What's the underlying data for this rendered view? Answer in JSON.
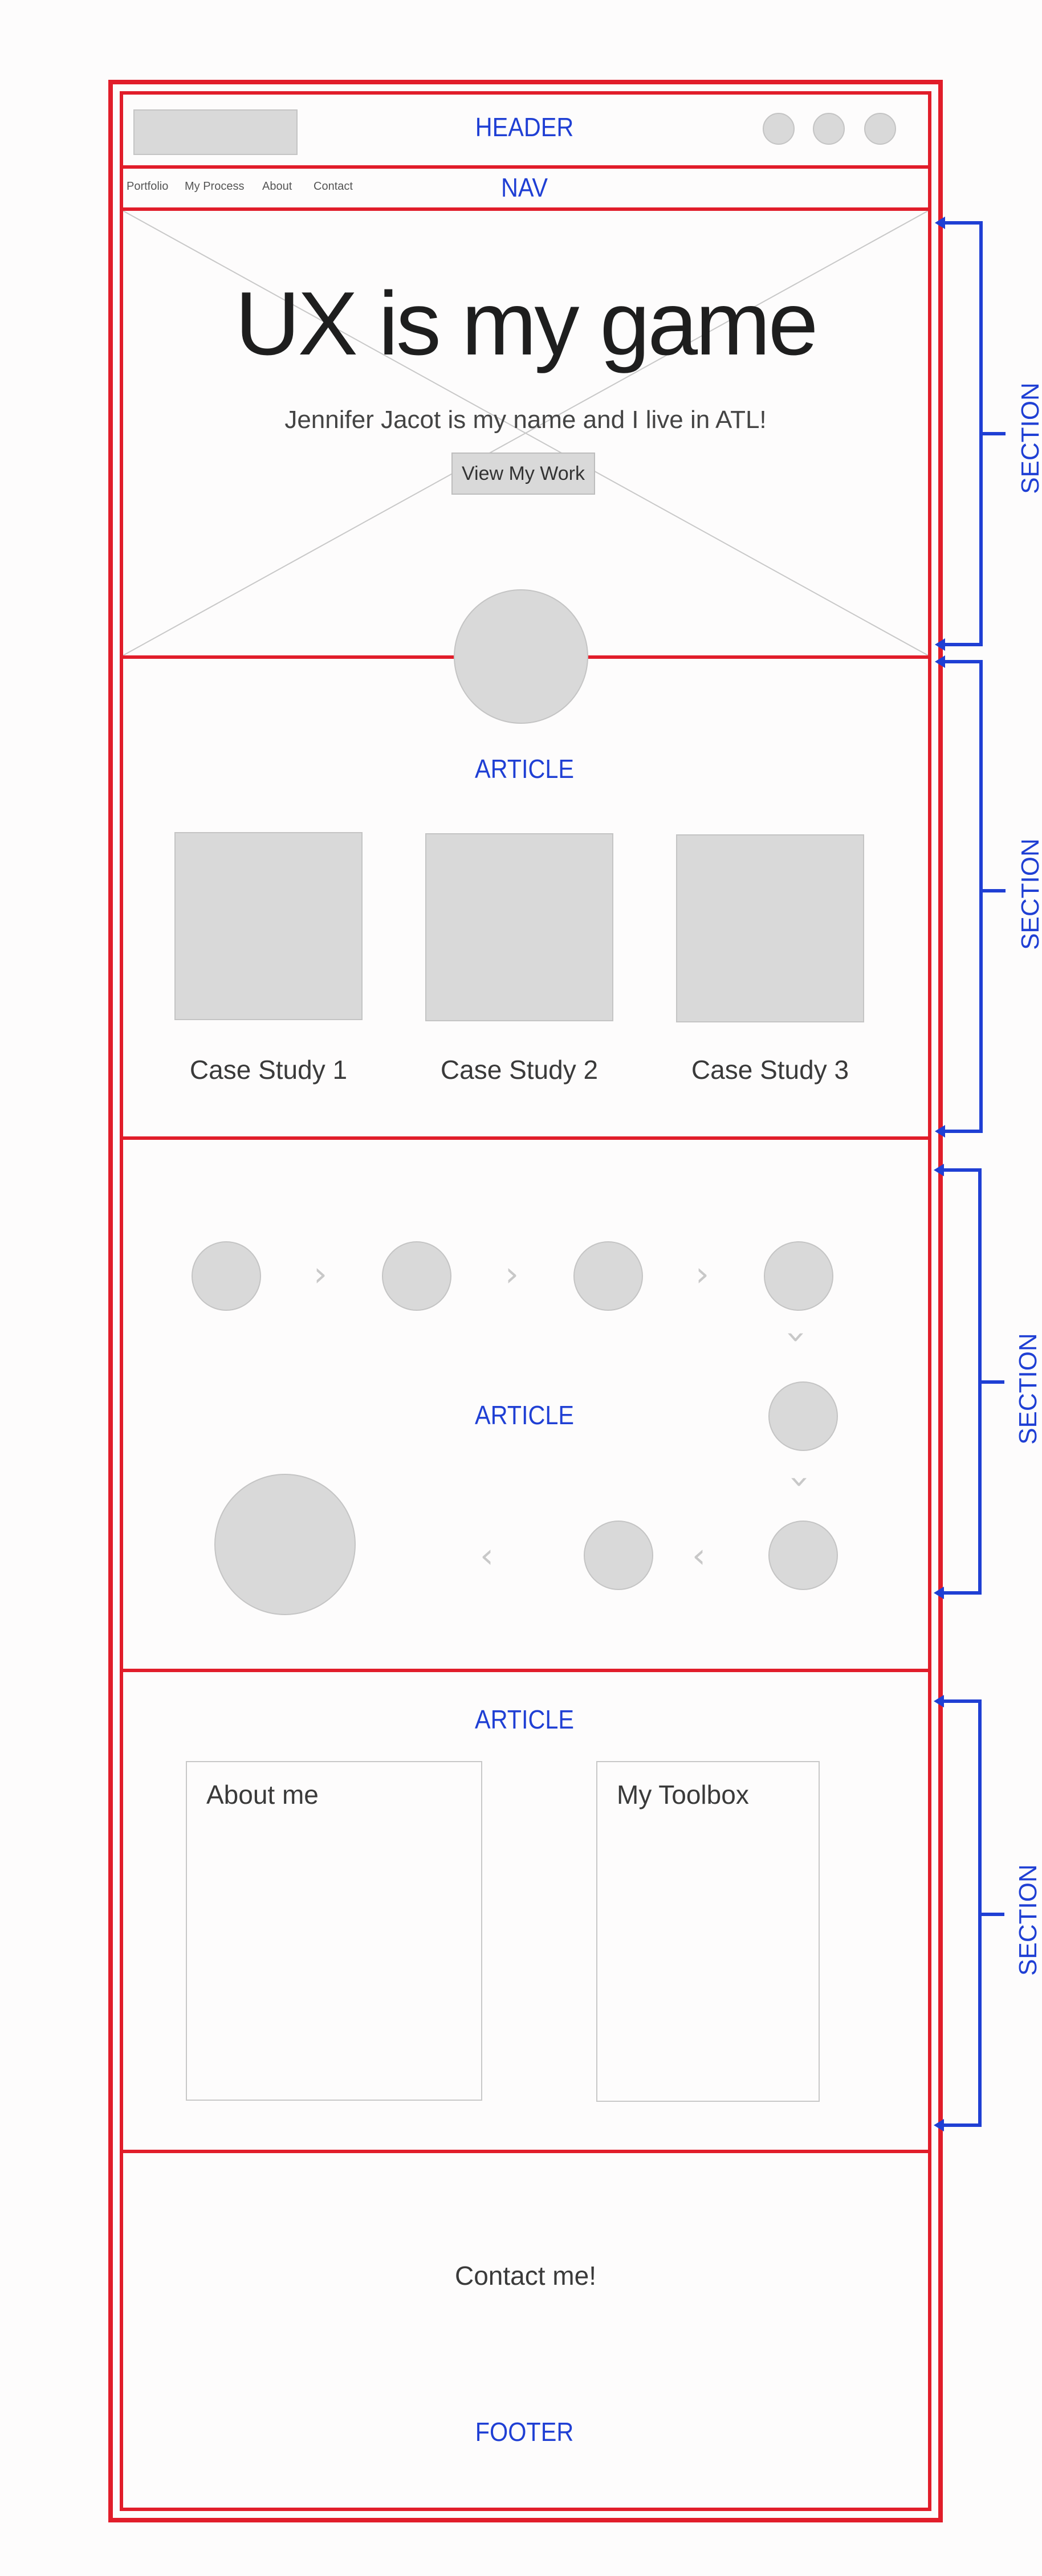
{
  "header": {
    "label": "HEADER"
  },
  "nav": {
    "label": "NAV",
    "links": [
      "Portfolio",
      "My Process",
      "About",
      "Contact"
    ]
  },
  "hero": {
    "title": "UX is my game",
    "subtitle": "Jennifer Jacot is my name and I live in ATL!",
    "cta_label": "View My Work"
  },
  "case_studies": {
    "label": "ARTICLE",
    "items": [
      "Case Study 1",
      "Case Study 2",
      "Case Study 3"
    ]
  },
  "process": {
    "label": "ARTICLE"
  },
  "about": {
    "label": "ARTICLE",
    "about_title": "About me",
    "toolbox_title": "My Toolbox"
  },
  "footer": {
    "contact_text": "Contact me!",
    "label": "FOOTER"
  },
  "annotations": {
    "section_label": "SECTION"
  },
  "colors": {
    "frame_red": "#e11d2a",
    "annotation_blue": "#1f3fd4",
    "placeholder_gray": "#d9d9d9"
  }
}
